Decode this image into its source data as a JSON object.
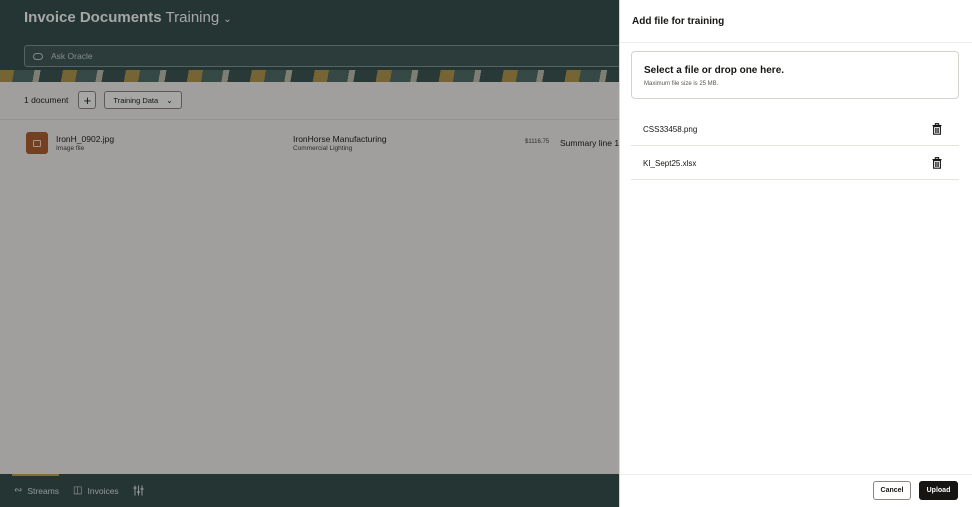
{
  "page": {
    "title": "Invoice Documents",
    "workspace": "Training",
    "ask_placeholder": "Ask Oracle",
    "doc_count": "1 document",
    "add_label": "+",
    "training_select": "Training Data"
  },
  "document": {
    "file_name": "IronH_0902.jpg",
    "file_type": "Image file",
    "vendor": "IronHorse Manufacturing",
    "vendor_sub": "Commercial Lighting",
    "amount": "$1116.75",
    "summary": "Summary line 1"
  },
  "bottom_nav": {
    "streams": "Streams",
    "invoices": "Invoices"
  },
  "drawer": {
    "title": "Add file for training",
    "dropzone_title": "Select a file or drop one here.",
    "dropzone_sub": "Maximum file size is 25 MB.",
    "files": [
      {
        "name": "CSS33458.png"
      },
      {
        "name": "KI_Sept25.xlsx"
      }
    ],
    "cancel_label": "Cancel",
    "upload_label": "Upload"
  },
  "colors": {
    "header": "#2f4a4a",
    "accent": "#c9a24b",
    "primary_button": "#161513"
  },
  "icons": {
    "trash": "trash-icon",
    "streams": "streams-icon",
    "invoices": "invoices-icon",
    "filters": "sliders-icon"
  }
}
